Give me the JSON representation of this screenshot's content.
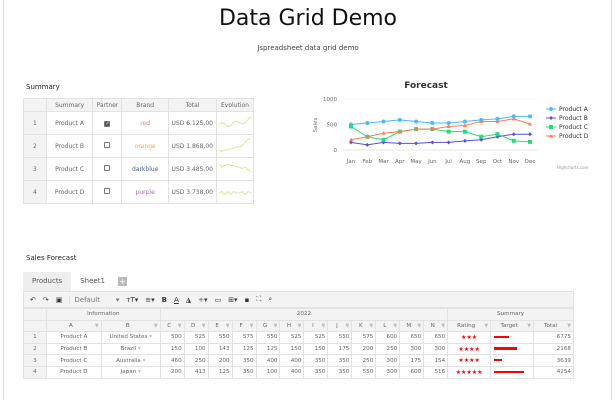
{
  "title": "Data Grid Demo",
  "subtitle": "Jspreadsheet data grid demo",
  "summary": {
    "label": "Summary",
    "headers": [
      "Summary",
      "Partner",
      "Brand",
      "Total",
      "Evolution"
    ],
    "rows": [
      {
        "index": "1",
        "name": "Product A",
        "partner": true,
        "brand": "red",
        "brand_color": "#f08080",
        "total": "USD 6.125,00",
        "spark": [
          3,
          5,
          4,
          2,
          3,
          5,
          6,
          5,
          4,
          5,
          7,
          9
        ]
      },
      {
        "index": "2",
        "name": "Product B",
        "partner": false,
        "brand": "orange",
        "brand_color": "#f5a75a",
        "total": "USD 1.868,00",
        "spark": [
          2,
          1,
          2,
          2,
          3,
          3,
          4,
          4,
          5,
          7,
          9,
          10
        ]
      },
      {
        "index": "3",
        "name": "Product C",
        "partner": false,
        "brand": "darkblue",
        "brand_color": "#4a5a8a",
        "total": "USD 3.485,00",
        "spark": [
          8,
          6,
          7,
          8,
          7,
          7,
          6,
          6,
          5,
          6,
          4,
          3
        ]
      },
      {
        "index": "4",
        "name": "Product D",
        "partner": false,
        "brand": "purple",
        "brand_color": "#a070b0",
        "total": "USD 3.738,00",
        "spark": [
          4,
          5,
          3,
          5,
          3,
          5,
          4,
          4,
          5,
          3,
          5,
          4
        ]
      }
    ]
  },
  "chart_data": {
    "type": "line",
    "title": "Forecast",
    "ylabel": "Sales",
    "ylim": [
      0,
      1000
    ],
    "yticks": [
      "0",
      "500",
      "1000"
    ],
    "categories": [
      "Jan",
      "Feb",
      "Mar",
      "Apr",
      "May",
      "Jun",
      "Jul",
      "Aug",
      "Sep",
      "Oct",
      "Nov",
      "Dec"
    ],
    "legend": "right",
    "credit": "Highcharts.com",
    "series": [
      {
        "name": "Product A",
        "color": "#4cb8ff",
        "marker": "circle",
        "values": [
          500,
          530,
          560,
          590,
          560,
          530,
          530,
          560,
          590,
          610,
          660,
          660
        ]
      },
      {
        "name": "Product B",
        "color": "#5b4fd4",
        "marker": "diamond",
        "values": [
          150,
          100,
          150,
          130,
          130,
          150,
          150,
          180,
          200,
          260,
          310,
          310
        ]
      },
      {
        "name": "Product C",
        "color": "#22dd77",
        "marker": "square",
        "values": [
          460,
          260,
          200,
          360,
          410,
          410,
          360,
          360,
          260,
          310,
          180,
          160
        ]
      },
      {
        "name": "Product D",
        "color": "#ff7a50",
        "marker": "triangle",
        "values": [
          200,
          260,
          330,
          360,
          410,
          410,
          460,
          480,
          560,
          560,
          610,
          510
        ]
      }
    ]
  },
  "sales": {
    "label": "Sales Forecast",
    "tabs": [
      "Products",
      "Sheet1"
    ],
    "toolbar": {
      "font": "Default"
    },
    "groups": [
      "Information",
      "2022",
      "Summary"
    ],
    "columns": [
      "A",
      "B",
      "C",
      "D",
      "E",
      "F",
      "G",
      "H",
      "I",
      "J",
      "K",
      "L",
      "M",
      "N",
      "Rating",
      "Target",
      "Total"
    ],
    "rows": [
      {
        "index": "1",
        "name": "Product A",
        "country": "United States",
        "values": [
          "500",
          "525",
          "550",
          "575",
          "550",
          "525",
          "525",
          "550",
          "575",
          "600",
          "650",
          "650"
        ],
        "rating": 3,
        "target": 0.3,
        "total": "6775"
      },
      {
        "index": "2",
        "name": "Product B",
        "country": "Brazil",
        "values": [
          "150",
          "100",
          "143",
          "125",
          "125",
          "150",
          "150",
          "175",
          "200",
          "250",
          "300",
          "300"
        ],
        "rating": 4,
        "target": 0.45,
        "total": "2168"
      },
      {
        "index": "3",
        "name": "Product C",
        "country": "Australia",
        "values": [
          "460",
          "250",
          "200",
          "350",
          "400",
          "400",
          "350",
          "350",
          "250",
          "300",
          "175",
          "154"
        ],
        "rating": 4,
        "target": 0.15,
        "total": "3639"
      },
      {
        "index": "4",
        "name": "Product D",
        "country": "Japan",
        "values": [
          "200",
          "413",
          "125",
          "350",
          "100",
          "400",
          "350",
          "350",
          "550",
          "300",
          "600",
          "516"
        ],
        "rating": 5,
        "target": 0.6,
        "total": "4254"
      }
    ]
  }
}
